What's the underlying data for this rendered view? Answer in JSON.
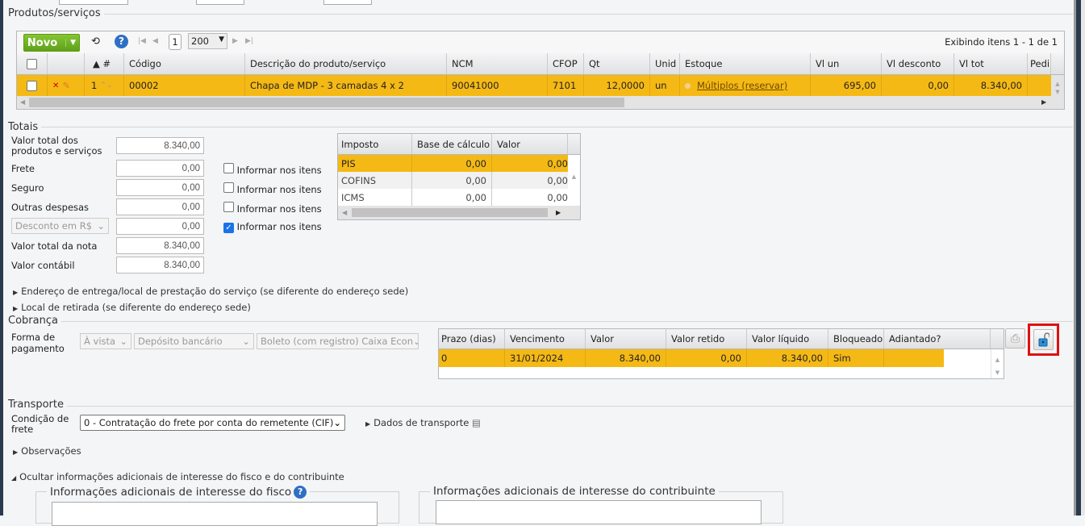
{
  "products": {
    "legend": "Produtos/serviços",
    "new_label": "Novo",
    "page": "1",
    "page_size": "200",
    "items_info": "Exibindo itens 1 - 1 de 1",
    "columns": [
      "▲ #",
      "Código",
      "Descrição do produto/serviço",
      "NCM",
      "CFOP",
      "Qt",
      "Unid",
      "Estoque",
      "Vl un",
      "Vl desconto",
      "Vl tot",
      "Pedi"
    ],
    "row": {
      "num": "1",
      "codigo": "00002",
      "descricao": "Chapa de MDP - 3 camadas 4 x 2",
      "ncm": "90041000",
      "cfop": "7101",
      "qt": "12,0000",
      "unid": "un",
      "estoque": "Múltiplos (reservar)",
      "vl_un": "695,00",
      "vl_desconto": "0,00",
      "vl_tot": "8.340,00"
    }
  },
  "totals": {
    "legend": "Totais",
    "valor_total_produtos_label": "Valor total dos produtos e serviços",
    "valor_total_produtos": "8.340,00",
    "frete_label": "Frete",
    "frete": "0,00",
    "seguro_label": "Seguro",
    "seguro": "0,00",
    "outras_label": "Outras despesas",
    "outras": "0,00",
    "desconto_select": "Desconto em R$",
    "desconto": "0,00",
    "valor_nota_label": "Valor total da nota",
    "valor_nota": "8.340,00",
    "valor_contabil_label": "Valor contábil",
    "valor_contabil": "8.340,00",
    "informar_label": "Informar nos itens",
    "informar_checked": [
      false,
      false,
      false,
      true
    ]
  },
  "taxes": {
    "columns": [
      "Imposto",
      "Base de cálculo",
      "Valor"
    ],
    "rows": [
      {
        "name": "PIS",
        "base": "0,00",
        "valor": "0,00"
      },
      {
        "name": "COFINS",
        "base": "0,00",
        "valor": "0,00"
      },
      {
        "name": "ICMS",
        "base": "0,00",
        "valor": "0,00"
      }
    ]
  },
  "expanders": {
    "endereco": "Endereço de entrega/local de prestação do serviço (se diferente do endereço sede)",
    "retirada": "Local de retirada (se diferente do endereço sede)"
  },
  "cobranca": {
    "legend": "Cobrança",
    "forma_label": "Forma de pagamento",
    "forma1": "À vista",
    "forma2": "Depósito bancário",
    "forma3": "Boleto (com registro) Caixa Econ",
    "columns": [
      "Prazo (dias)",
      "Vencimento",
      "Valor",
      "Valor retido",
      "Valor líquido",
      "Bloqueado",
      "Adiantado?"
    ],
    "row": {
      "prazo": "0",
      "vencimento": "31/01/2024",
      "valor": "8.340,00",
      "retido": "0,00",
      "liquido": "8.340,00",
      "bloqueado": "Sim",
      "adiantado": ""
    }
  },
  "transporte": {
    "legend": "Transporte",
    "condicao_label": "Condição de frete",
    "condicao": "0 - Contratação do frete por conta do remetente (CIF)",
    "dados": "Dados de transporte"
  },
  "observacoes": "Observações",
  "ocultar": "Ocultar informações adicionais de interesse do fisco e do contribuinte",
  "info_fisco": "Informações adicionais de interesse do fisco",
  "info_contribuinte": "Informações adicionais de interesse do contribuinte"
}
